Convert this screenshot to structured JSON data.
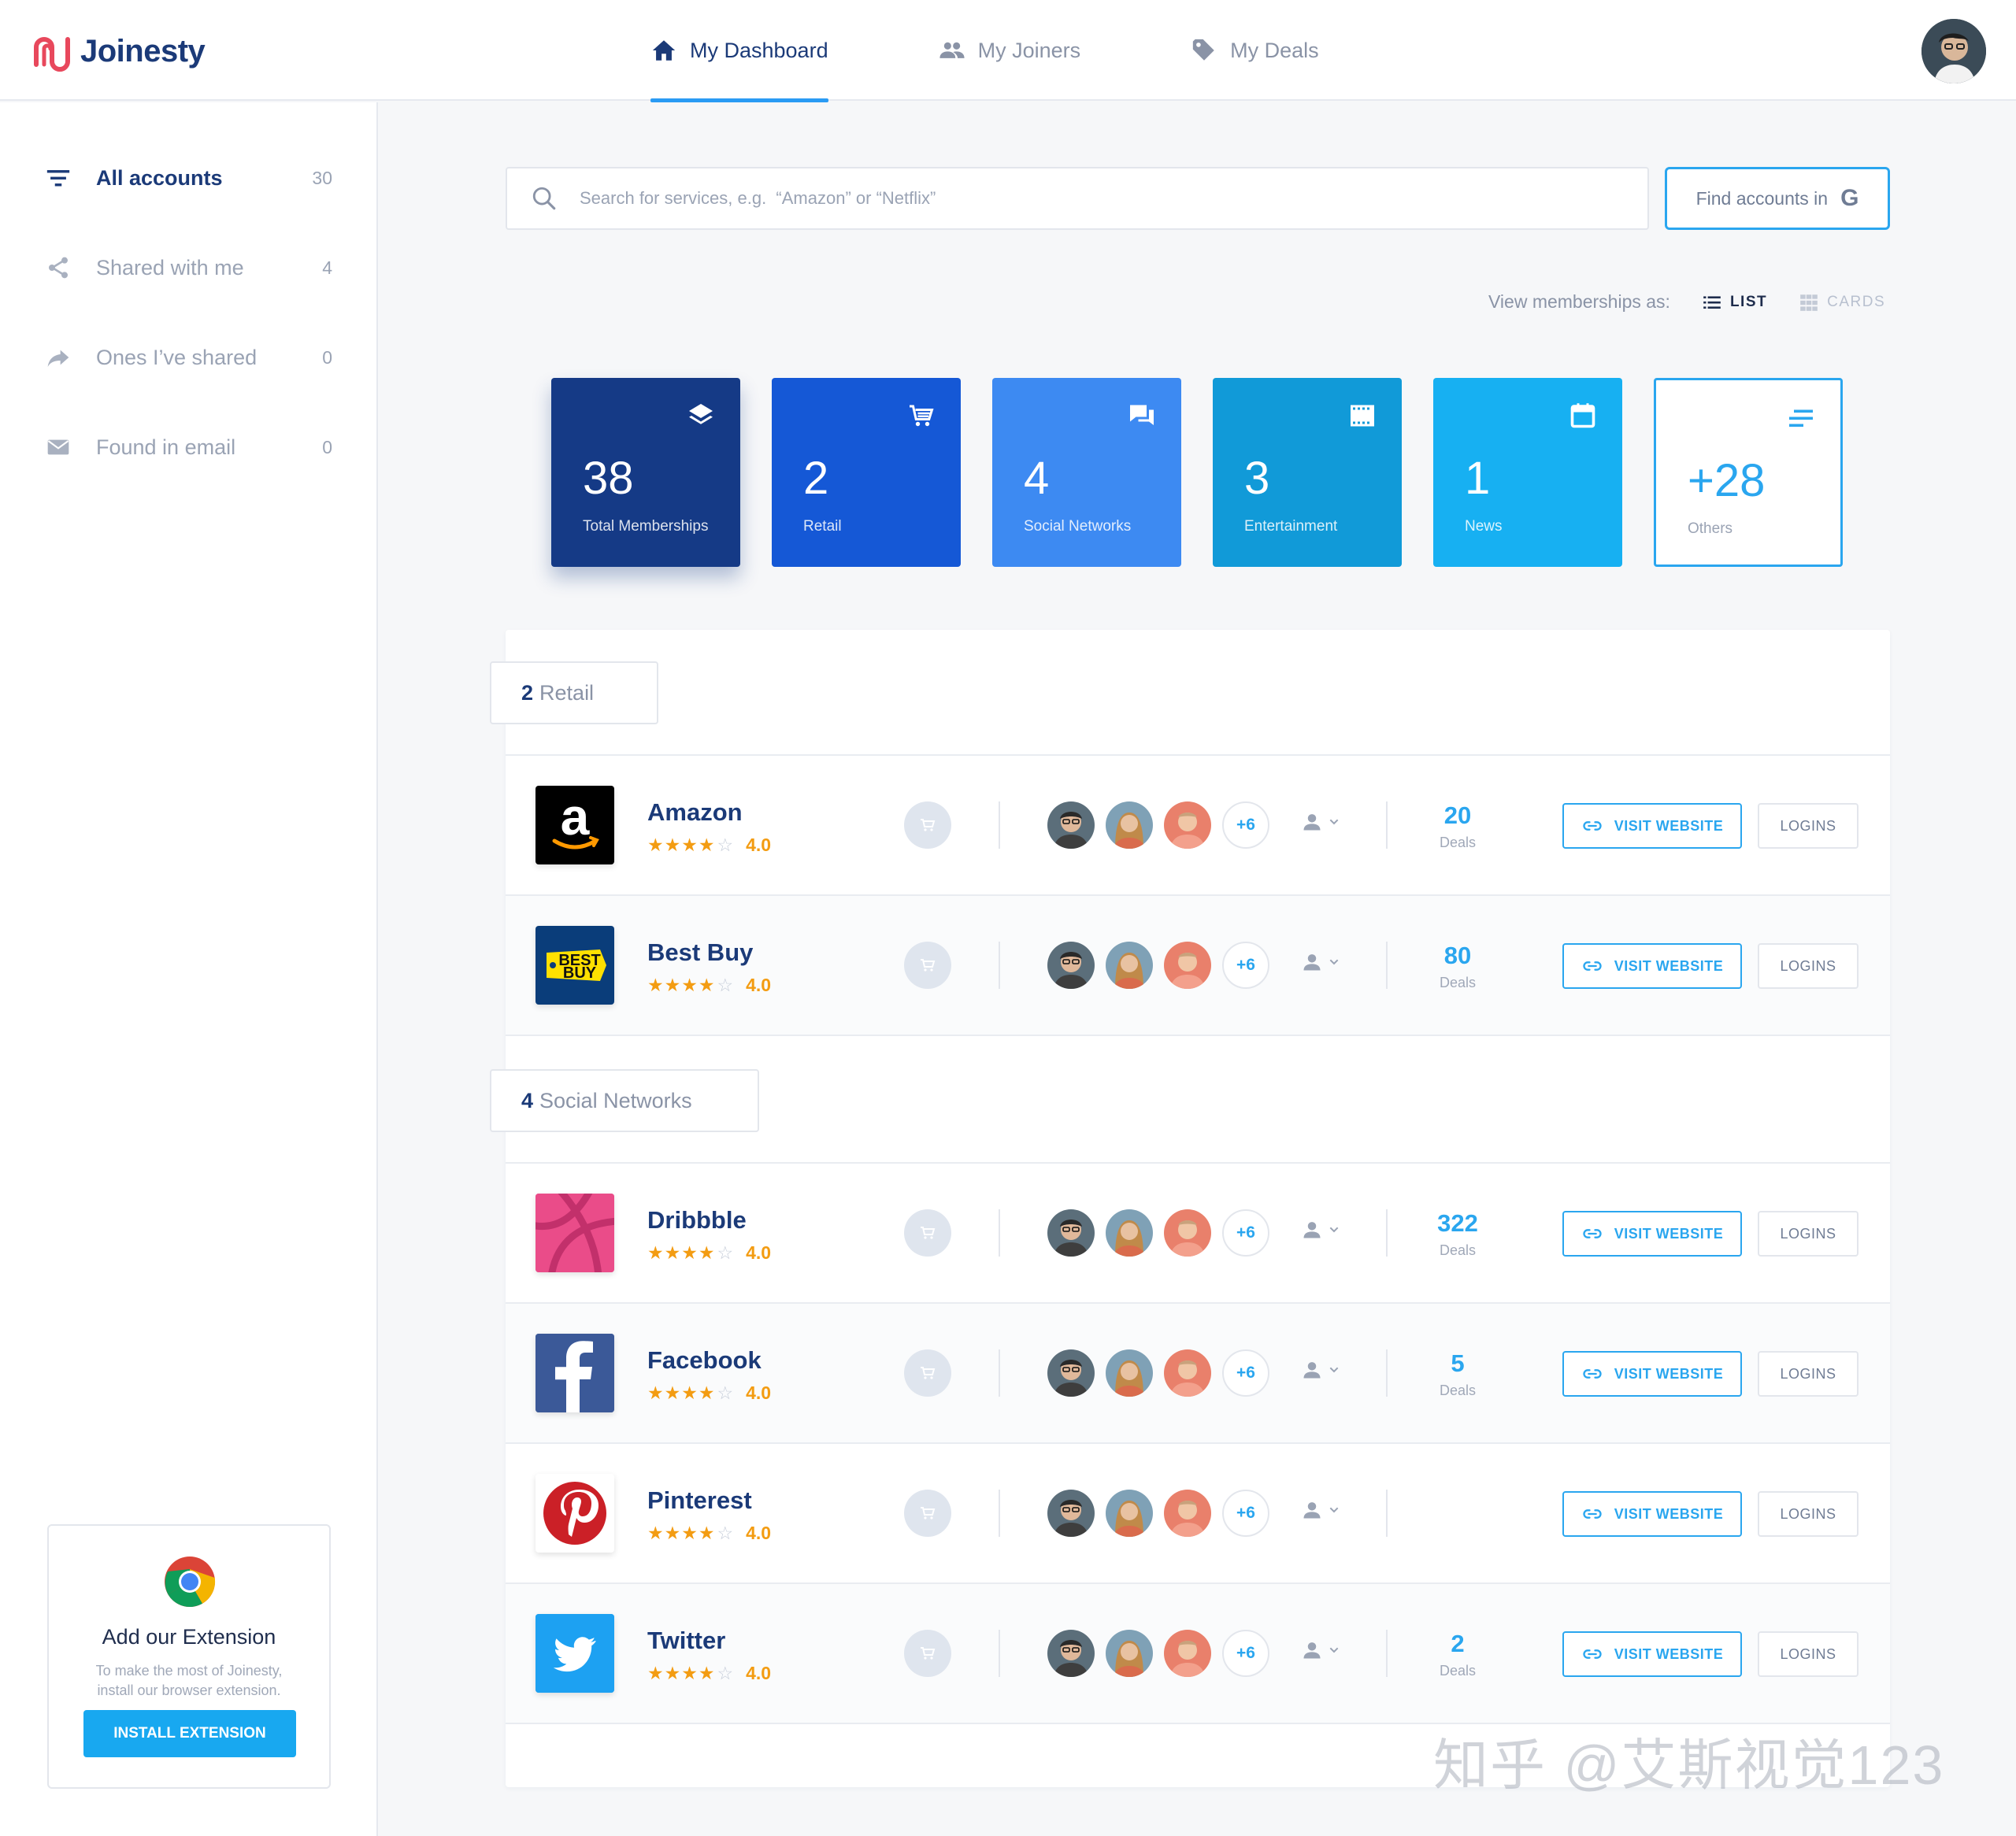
{
  "brand": {
    "name": "Joinesty"
  },
  "nav": [
    {
      "label": "My Dashboard",
      "icon": "home-icon",
      "active": true
    },
    {
      "label": "My Joiners",
      "icon": "people-icon",
      "active": false
    },
    {
      "label": "My Deals",
      "icon": "tag-icon",
      "active": false
    }
  ],
  "sidebar": {
    "items": [
      {
        "label": "All accounts",
        "count": "30",
        "icon": "filter-icon",
        "active": true
      },
      {
        "label": "Shared with me",
        "count": "4",
        "icon": "share-icon",
        "active": false
      },
      {
        "label": "Ones I’ve shared",
        "count": "0",
        "icon": "forward-icon",
        "active": false
      },
      {
        "label": "Found in email",
        "count": "0",
        "icon": "mail-icon",
        "active": false
      }
    ],
    "extension": {
      "title": "Add our Extension",
      "desc": "To make the most of Joinesty, install our browser extension.",
      "button": "INSTALL EXTENSION"
    }
  },
  "search": {
    "placeholder": "Search for services, e.g.  “Amazon” or “Netflix”",
    "find_label": "Find accounts in",
    "find_glyph": "G"
  },
  "view": {
    "label": "View memberships as:",
    "list": "LIST",
    "cards": "CARDS",
    "selected": "LIST"
  },
  "tiles": [
    {
      "num": "38",
      "label": "Total Memberships",
      "color": "#153a86",
      "icon": "layers-icon"
    },
    {
      "num": "2",
      "label": "Retail",
      "color": "#1558d6",
      "icon": "cart-icon"
    },
    {
      "num": "4",
      "label": "Social Networks",
      "color": "#3d8af2",
      "icon": "chat-icon"
    },
    {
      "num": "3",
      "label": "Entertainment",
      "color": "#119ad8",
      "icon": "film-icon"
    },
    {
      "num": "1",
      "label": "News",
      "color": "#17b0f2",
      "icon": "calendar-icon"
    },
    {
      "num": "+28",
      "label": "Others",
      "color": "#ffffff",
      "icon": "lines-icon"
    }
  ],
  "sections": [
    {
      "count": "2",
      "name": "Retail"
    },
    {
      "count": "4",
      "name": "Social Networks"
    }
  ],
  "rows": [
    {
      "name": "Amazon",
      "rating": "4.0",
      "deals": "20",
      "deals_label": "Deals",
      "more": "+6",
      "visit": "VISIT WEBSITE",
      "logins": "LOGINS"
    },
    {
      "name": "Best Buy",
      "rating": "4.0",
      "deals": "80",
      "deals_label": "Deals",
      "more": "+6",
      "visit": "VISIT WEBSITE",
      "logins": "LOGINS",
      "logo_text_1": "BEST",
      "logo_text_2": "BUY"
    },
    {
      "name": "Dribbble",
      "rating": "4.0",
      "deals": "322",
      "deals_label": "Deals",
      "more": "+6",
      "visit": "VISIT WEBSITE",
      "logins": "LOGINS"
    },
    {
      "name": "Facebook",
      "rating": "4.0",
      "deals": "5",
      "deals_label": "Deals",
      "more": "+6",
      "visit": "VISIT WEBSITE",
      "logins": "LOGINS"
    },
    {
      "name": "Pinterest",
      "rating": "4.0",
      "deals": "",
      "deals_label": "",
      "more": "+6",
      "visit": "VISIT WEBSITE",
      "logins": "LOGINS"
    },
    {
      "name": "Twitter",
      "rating": "4.0",
      "deals": "2",
      "deals_label": "Deals",
      "more": "+6",
      "visit": "VISIT WEBSITE",
      "logins": "LOGINS"
    }
  ],
  "rating_stars": {
    "filled": "★★★★",
    "empty": "☆"
  },
  "watermark": "知乎 @艾斯视觉123"
}
